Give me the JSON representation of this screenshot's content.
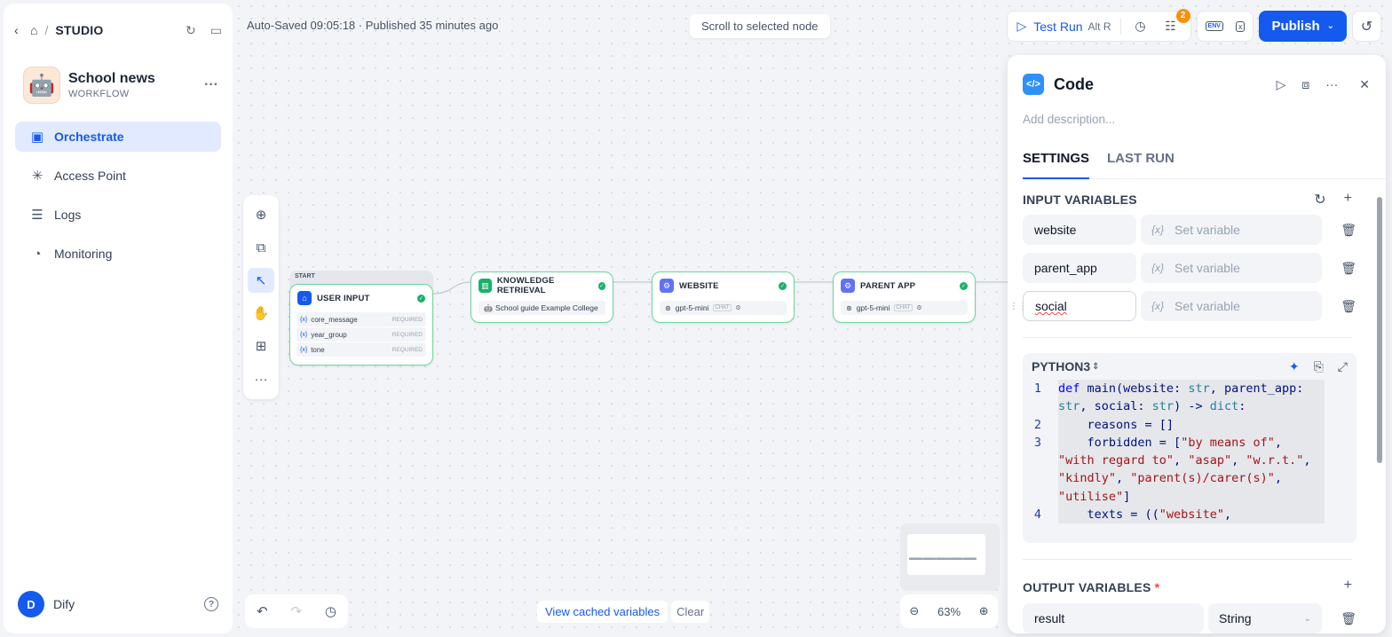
{
  "sidebar": {
    "crumb": "STUDIO",
    "app_name": "School news",
    "app_type": "WORKFLOW",
    "nav": [
      {
        "label": "Orchestrate",
        "icon": "orchestrate-icon",
        "active": true
      },
      {
        "label": "Access Point",
        "icon": "access-point-icon"
      },
      {
        "label": "Logs",
        "icon": "logs-icon"
      },
      {
        "label": "Monitoring",
        "icon": "monitoring-icon"
      }
    ],
    "user_initial": "D",
    "user_name": "Dify"
  },
  "topbar": {
    "autosave": "Auto-Saved 09:05:18 · Published 35 minutes ago",
    "scroll_to_selected": "Scroll to selected node",
    "test_run": "Test Run",
    "test_run_keys": "Alt  R",
    "checklist_count": "2",
    "env_label": "ENV",
    "publish": "Publish"
  },
  "nodes": {
    "start_label": "START",
    "user_input": {
      "title": "USER INPUT",
      "vars": [
        {
          "name": "core_message",
          "req": "REQUIRED"
        },
        {
          "name": "year_group",
          "req": "REQUIRED"
        },
        {
          "name": "tone",
          "req": "REQUIRED"
        }
      ]
    },
    "knowledge": {
      "title": "KNOWLEDGE RETRIEVAL",
      "dataset": "School guide Example College"
    },
    "website": {
      "title": "WEBSITE",
      "model": "gpt-5-mini",
      "mode": "CHAT"
    },
    "parent_app": {
      "title": "PARENT APP",
      "model": "gpt-5-mini",
      "mode": "CHAT"
    }
  },
  "canvas_bottom": {
    "view_cached": "View cached variables",
    "clear": "Clear",
    "zoom": "63%"
  },
  "panel": {
    "title": "Code",
    "description_placeholder": "Add description...",
    "tabs": [
      "SETTINGS",
      "LAST RUN"
    ],
    "input_title": "INPUT VARIABLES",
    "inputs": [
      {
        "name": "website",
        "value_placeholder": "Set variable"
      },
      {
        "name": "parent_app",
        "value_placeholder": "Set variable"
      },
      {
        "name": "social",
        "value_placeholder": "Set variable"
      }
    ],
    "language": "PYTHON3",
    "code_lines": [
      {
        "n": "1",
        "text": "def main(website: str, parent_app: str, social: str) -> dict:"
      },
      {
        "n": "2",
        "text": "    reasons = []"
      },
      {
        "n": "3",
        "text": "    forbidden = [\"by means of\", \"with regard to\", \"asap\", \"w.r.t.\", \"kindly\", \"parent(s)/carer(s)\", \"utilise\"]"
      },
      {
        "n": "4",
        "text": "    texts = ((\"website\","
      }
    ],
    "output_title": "OUTPUT VARIABLES",
    "output": {
      "name": "result",
      "type": "String"
    }
  },
  "colors": {
    "accent": "#155aef",
    "node_border": "#6ed69b",
    "success": "#17b26a",
    "badge": "#f79009"
  }
}
